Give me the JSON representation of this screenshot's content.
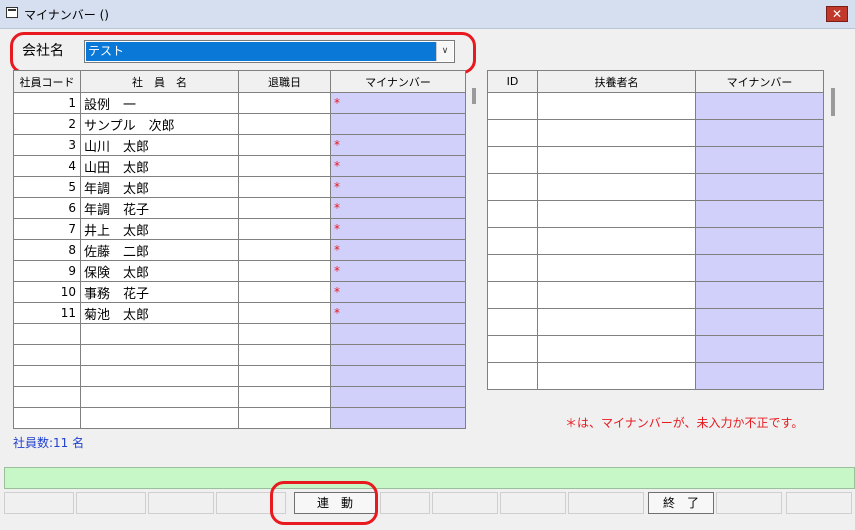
{
  "window": {
    "title": "マイナンバー  ()",
    "close_label": "✕"
  },
  "company": {
    "label": "会社名",
    "value": "テスト"
  },
  "employees": {
    "headers": [
      "社員コード",
      "社　員　名",
      "退職日",
      "マイナンバー"
    ],
    "rows": [
      {
        "code": "1",
        "name": "設例　一",
        "retired": "",
        "mynumber": "*"
      },
      {
        "code": "2",
        "name": "サンプル　次郎",
        "retired": "",
        "mynumber": ""
      },
      {
        "code": "3",
        "name": "山川　太郎",
        "retired": "",
        "mynumber": "*"
      },
      {
        "code": "4",
        "name": "山田　太郎",
        "retired": "",
        "mynumber": "*"
      },
      {
        "code": "5",
        "name": "年調　太郎",
        "retired": "",
        "mynumber": "*"
      },
      {
        "code": "6",
        "name": "年調　花子",
        "retired": "",
        "mynumber": "*"
      },
      {
        "code": "7",
        "name": "井上　太郎",
        "retired": "",
        "mynumber": "*"
      },
      {
        "code": "8",
        "name": "佐藤　二郎",
        "retired": "",
        "mynumber": "*"
      },
      {
        "code": "9",
        "name": "保険　太郎",
        "retired": "",
        "mynumber": "*"
      },
      {
        "code": "10",
        "name": "事務　花子",
        "retired": "",
        "mynumber": "*"
      },
      {
        "code": "11",
        "name": "菊池　太郎",
        "retired": "",
        "mynumber": "*"
      },
      {
        "code": "",
        "name": "",
        "retired": "",
        "mynumber": ""
      },
      {
        "code": "",
        "name": "",
        "retired": "",
        "mynumber": ""
      },
      {
        "code": "",
        "name": "",
        "retired": "",
        "mynumber": ""
      },
      {
        "code": "",
        "name": "",
        "retired": "",
        "mynumber": ""
      },
      {
        "code": "",
        "name": "",
        "retired": "",
        "mynumber": ""
      }
    ],
    "count_text": "社員数:11 名"
  },
  "dependents": {
    "headers": [
      "ID",
      "扶養者名",
      "マイナンバー"
    ],
    "rows": [
      {},
      {},
      {},
      {},
      {},
      {},
      {},
      {},
      {},
      {},
      {}
    ]
  },
  "note": "＊は、マイナンバーが、未入力か不正です。",
  "fkeys": {
    "link_label": "連　動",
    "exit_label": "終　了"
  },
  "colors": {
    "accent_red": "#e8191f",
    "selection_blue": "#0a78d7",
    "mynumber_bg": "#d0d0fa",
    "status_green": "#c7f7c7"
  }
}
